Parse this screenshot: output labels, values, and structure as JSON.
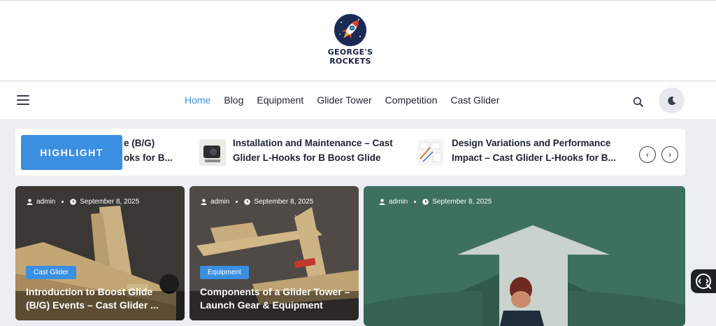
{
  "site": {
    "logo_line1": "GEORGE'S",
    "logo_line2": "ROCKETS"
  },
  "nav": {
    "items": [
      "Home",
      "Blog",
      "Equipment",
      "Glider Tower",
      "Competition",
      "Cast Glider"
    ],
    "active": "Home"
  },
  "ticker": {
    "badge": "HIGHLIGHT",
    "items": [
      {
        "line1": "e (B/G)",
        "line2": "oks for B..."
      },
      {
        "line1": "Installation and Maintenance – Cast",
        "line2": "Glider L-Hooks for B Boost Glide"
      },
      {
        "line1": "Design Variations and Performance",
        "line2": "Impact – Cast Glider L-Hooks for B..."
      }
    ],
    "prev_icon": "‹",
    "next_icon": "›"
  },
  "cards": [
    {
      "author": "admin",
      "date": "September 8, 2025",
      "category": "Cast Glider",
      "title": "Introduction to Boost Glide (B/G) Events – Cast Glider ..."
    },
    {
      "author": "admin",
      "date": "September 8, 2025",
      "category": "Equipment",
      "title": "Components of a Glider Tower – Launch Gear & Equipment"
    },
    {
      "author": "admin",
      "date": "September 8, 2025"
    }
  ],
  "colors": {
    "accent": "#3b8fe0",
    "page_bg": "#eceef3"
  },
  "icons": {
    "menu": "hamburger-menu-icon",
    "search": "search-icon",
    "theme": "moon-icon",
    "author": "user-icon",
    "date": "clock-icon"
  }
}
